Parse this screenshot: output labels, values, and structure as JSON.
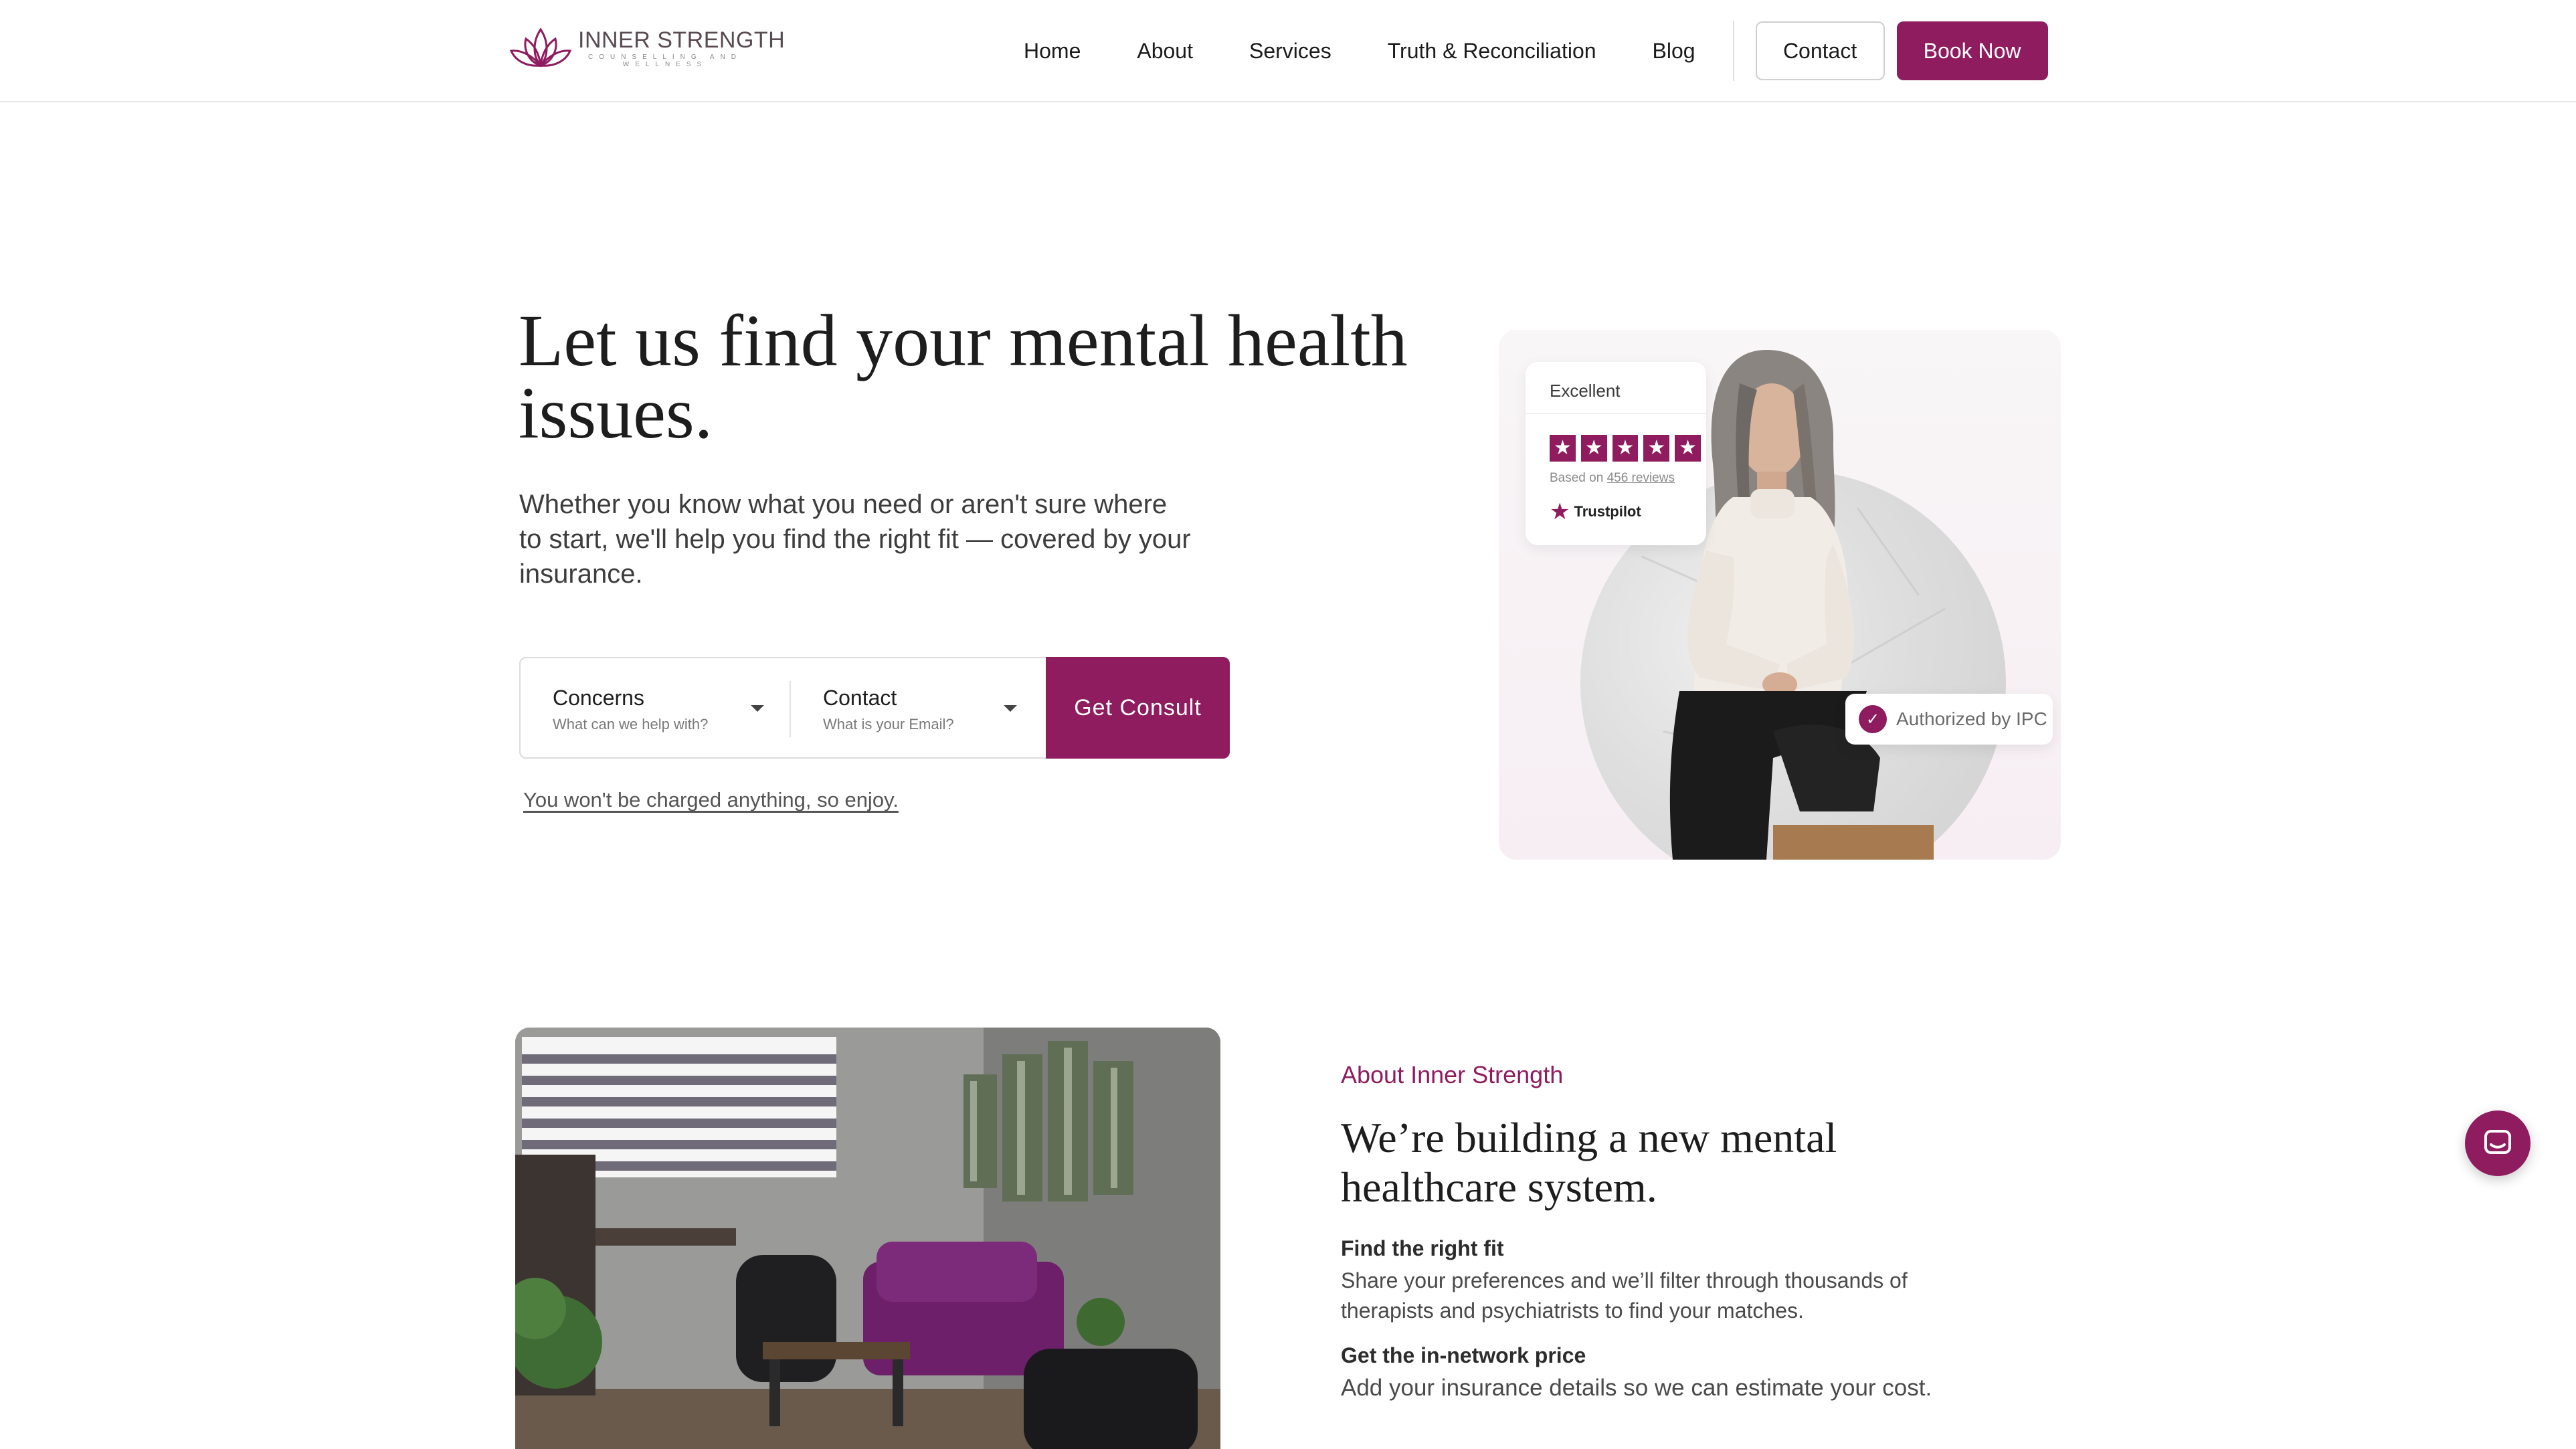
{
  "brand": {
    "name": "INNER STRENGTH",
    "tagline": "COUNSELLING AND WELLNESS",
    "accent_color": "#8e1c5f"
  },
  "nav": {
    "links": [
      "Home",
      "About",
      "Services",
      "Truth & Reconciliation",
      "Blog"
    ],
    "contact_label": "Contact",
    "book_label": "Book Now"
  },
  "hero": {
    "title": "Let us find your mental health issues.",
    "description": "Whether you know what you need or aren't sure where to start, we'll help you find the right fit — covered by your insurance.",
    "concerns_label": "Concerns",
    "concerns_hint": "What can we help with?",
    "contact_label": "Contact",
    "contact_hint": "What is your Email?",
    "cta_label": "Get Consult",
    "fine_print": "You won't be charged anything, so enjoy."
  },
  "rating": {
    "label": "Excellent",
    "stars": 5,
    "based_on_prefix": "Based on ",
    "reviews_link": "456 reviews",
    "provider": "Trustpilot"
  },
  "badge": {
    "text": "Authorized by IPC"
  },
  "about": {
    "kicker": "About Inner Strength",
    "title": "We’re building a new mental healthcare system.",
    "features": [
      {
        "title": "Find the right fit",
        "desc": "Share your preferences and we’ll filter through thousands of therapists and psychiatrists to find your matches."
      },
      {
        "title": "Get the in-network price",
        "desc": "Add your insurance details so we can estimate your cost."
      }
    ]
  },
  "icons": {
    "logo": "lotus-icon",
    "caret": "chevron-down-icon",
    "star": "star-icon",
    "check": "check-icon",
    "chat": "chat-icon"
  }
}
